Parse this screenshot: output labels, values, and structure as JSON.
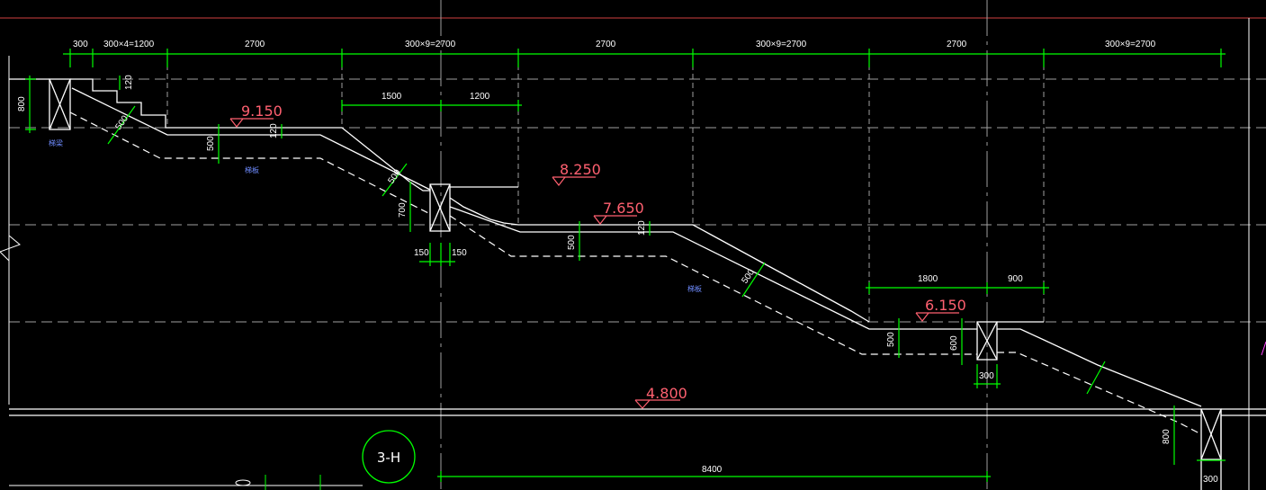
{
  "colors": {
    "background": "#000000",
    "outline": "#ffffff",
    "dimension": "#00ff00",
    "level_mark": "#ff6070",
    "note": "#6f8cff",
    "axis": "#a0a0a0"
  },
  "top_dimensions": [
    "300",
    "300×4=1200",
    "2700",
    "300×9=2700",
    "2700",
    "300×9=2700",
    "2700",
    "300×9=2700"
  ],
  "inner_dimensions": {
    "d1500": "1500",
    "d1200": "1200",
    "d1800": "1800",
    "d900": "900",
    "d150a": "150",
    "d150b": "150",
    "d300a": "300",
    "d300b": "300",
    "d8400": "8400"
  },
  "vertical_dimensions": {
    "d800": "800",
    "d120a": "120",
    "d500a": "500",
    "d120b": "120",
    "d500b": "500",
    "d700": "700",
    "d500c": "500",
    "d120c": "120",
    "d500d": "500",
    "d500e": "500",
    "d600": "600",
    "d500f": "500",
    "d800b": "800"
  },
  "levels": {
    "l9150": "9.150",
    "l8250": "8.250",
    "l7650": "7.650",
    "l6150": "6.150",
    "l4800": "4.800"
  },
  "axis_bubble": "3-H",
  "notes": {
    "n1": "梯梁",
    "n2": "梯板",
    "n3": "梯板"
  }
}
